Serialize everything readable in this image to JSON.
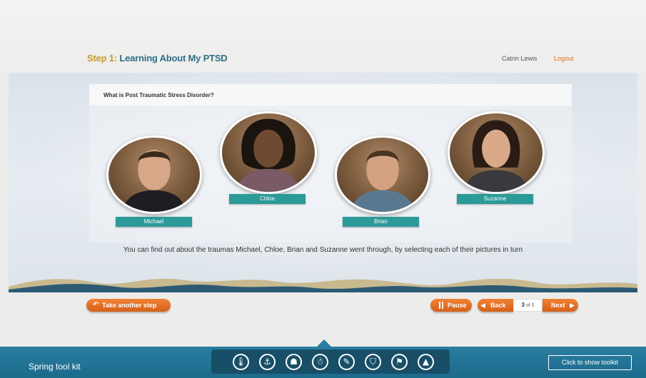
{
  "header": {
    "step_prefix": "Step 1:",
    "step_name": "Learning About My PTSD",
    "user_name": "Catrin Lewis",
    "logout_label": "Logout"
  },
  "content": {
    "question": "What is Post Traumatic Stress Disorder?",
    "instruction": "You can find out about the traumas Michael, Chloe, Brian and Suzanne went through, by selecting each of their pictures in turn",
    "people": [
      {
        "name": "Michael"
      },
      {
        "name": "Chloe"
      },
      {
        "name": "Brian"
      },
      {
        "name": "Suzanne"
      }
    ]
  },
  "nav": {
    "take_another_label": "Take another step",
    "pause_label": "Pause",
    "back_label": "Back",
    "page_current": "3",
    "page_total_text": "of 5",
    "next_label": "Next"
  },
  "toolbar": {
    "title": "Spring tool kit",
    "show_toolkit_label": "Click to show toolkit",
    "icons": [
      "thermometer-icon",
      "anchor-icon",
      "meditation-icon",
      "person-icon",
      "notes-icon",
      "shield-icon",
      "walking-icon",
      "mountain-icon"
    ]
  },
  "colors": {
    "accent_orange": "#e0731e",
    "teal_tag": "#2b9a98",
    "title_blue": "#2f6f86",
    "title_gold": "#c49a2c",
    "toolbar_blue": "#1f6f92"
  }
}
